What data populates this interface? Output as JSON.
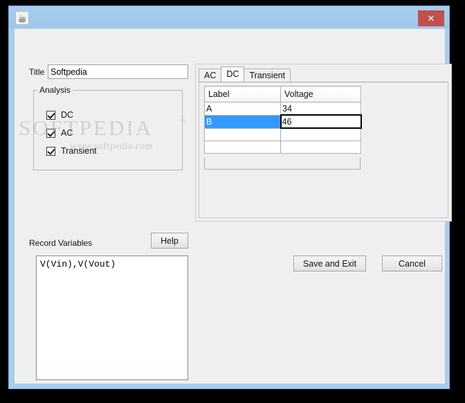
{
  "window": {
    "icon_name": "java-coffee-cup-icon",
    "close_label": "✕"
  },
  "watermark": {
    "main": "SOFTPEDIA",
    "trademark": "™",
    "sub": "www.softpedia.com"
  },
  "form": {
    "title_label": "Title",
    "title_value": "Softpedia",
    "title_placeholder": ""
  },
  "analysis": {
    "legend": "Analysis",
    "options": [
      {
        "label": "DC",
        "checked": true
      },
      {
        "label": "AC",
        "checked": true
      },
      {
        "label": "Transient",
        "checked": true
      }
    ]
  },
  "tabs": {
    "items": [
      {
        "label": "AC",
        "active": false
      },
      {
        "label": "DC",
        "active": true
      },
      {
        "label": "Transient",
        "active": false
      }
    ]
  },
  "table": {
    "columns": [
      "Label",
      "Voltage"
    ],
    "rows": [
      {
        "label": "A",
        "voltage": "34",
        "selected": false,
        "editing": false
      },
      {
        "label": "B",
        "voltage": "46",
        "selected": true,
        "editing": true
      },
      {
        "label": "",
        "voltage": "",
        "selected": false,
        "editing": false
      },
      {
        "label": "",
        "voltage": "",
        "selected": false,
        "editing": false
      }
    ]
  },
  "record": {
    "label": "Record Variables",
    "help_label": "Help",
    "value": "V(Vin),V(Vout)",
    "placeholder": ""
  },
  "actions": {
    "save_label": "Save and Exit",
    "cancel_label": "Cancel"
  },
  "colors": {
    "titlebar": "#a8ceef",
    "close": "#c0504d",
    "selection": "#3399ff",
    "client": "#efefef"
  }
}
